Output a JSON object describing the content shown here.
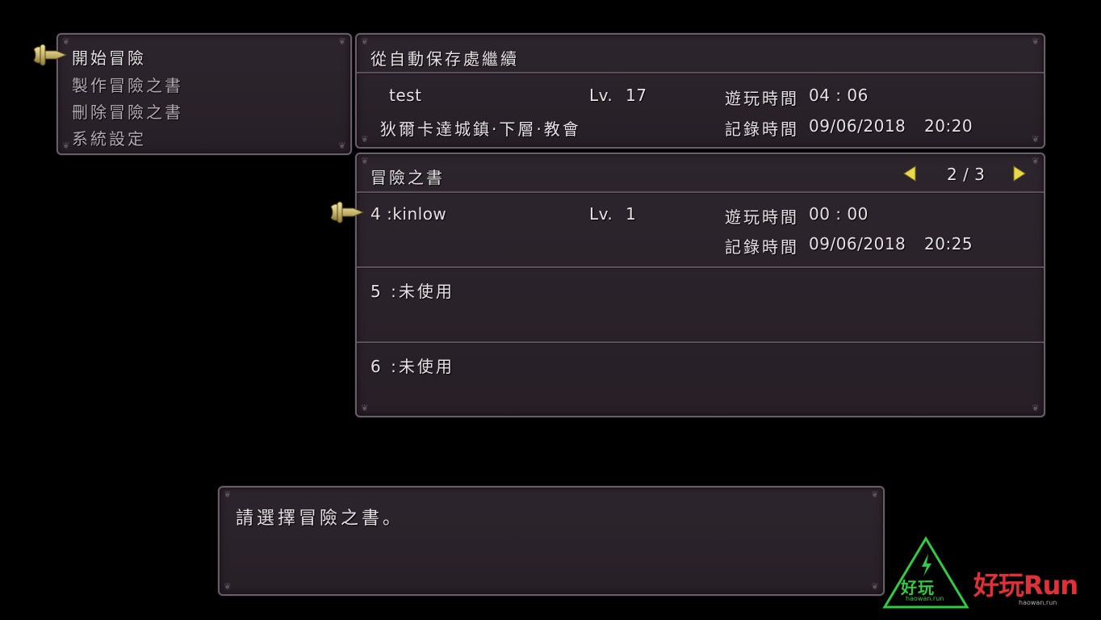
{
  "main_menu": {
    "items": [
      {
        "label": "開始冒險",
        "selected": true
      },
      {
        "label": "製作冒險之書",
        "selected": false
      },
      {
        "label": "刪除冒險之書",
        "selected": false
      },
      {
        "label": "系統設定",
        "selected": false
      }
    ]
  },
  "autosave": {
    "header": "從自動保存處繼續",
    "name": "test",
    "level_label": "Lv.",
    "level": "17",
    "location": "狄爾卡達城鎮·下層·教會",
    "playtime_label": "遊玩時間",
    "playtime": "04 : 06",
    "record_label": "記錄時間",
    "record_date": "09/06/2018",
    "record_time": "20:20"
  },
  "books": {
    "header": "冒險之書",
    "page": "2 / 3",
    "slots": [
      {
        "label": "4 :kinlow",
        "level_label": "Lv.",
        "level": "1",
        "playtime_label": "遊玩時間",
        "playtime": "00 : 00",
        "record_label": "記錄時間",
        "record_date": "09/06/2018",
        "record_time": "20:25",
        "selected": true
      },
      {
        "label": "5 :未使用"
      },
      {
        "label": "6 :未使用"
      }
    ]
  },
  "message": {
    "text": "請選擇冒險之書。"
  },
  "watermark": {
    "logo_text": "好玩",
    "logo_sub": "haowan.run",
    "brand_text": "好玩Run",
    "brand_sub": "haowan.run"
  },
  "colors": {
    "panel_bg": "#2b232a",
    "panel_border": "#6a5d6a",
    "text": "#e6e2e6",
    "cursor_gold": "#c9b870",
    "arrow_yellow": "#e8d84a",
    "logo_green": "#2ecc40",
    "brand_red": "#e0303a"
  }
}
